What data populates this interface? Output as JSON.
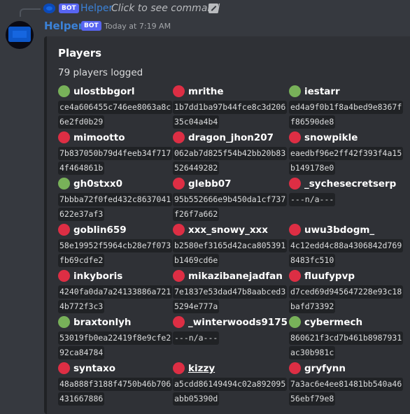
{
  "reply": {
    "badge": "BOT",
    "name": "Helper",
    "command_text": "Click to see command"
  },
  "message": {
    "author": "Helper",
    "badge": "BOT",
    "timestamp": "Today at 7:19 AM"
  },
  "embed": {
    "title": "Players",
    "description": "79 players logged",
    "fields": [
      {
        "name": "ulostbbgorl",
        "status": "green",
        "line1": "ce4a606455c746ee8063a8c",
        "line2": "6e2fd0b29"
      },
      {
        "name": "mrithe",
        "status": "red",
        "line1": "1b7dd1ba97b44fce8c3d206",
        "line2": "35c04a4b4"
      },
      {
        "name": "iestarr",
        "status": "green",
        "line1": "ed4a9f0b1f8a4bed9e8367f",
        "line2": "f86590de8"
      },
      {
        "name": "mimootto",
        "status": "red",
        "line1": "7b837050b79d4feeb34f717",
        "line2": "4f464861b"
      },
      {
        "name": "dragon_jhon207",
        "status": "red",
        "line1": "062ab7d825f54b42bb20b83",
        "line2": "526449282"
      },
      {
        "name": "snowpikle",
        "status": "red",
        "line1": "eaedbf96e2ff42f393f4a15",
        "line2": "b149178e0"
      },
      {
        "name": "gh0stxx0",
        "status": "green",
        "line1": "7bbba72f0fed432c8637041",
        "line2": "622e37af3"
      },
      {
        "name": "glebb07",
        "status": "red",
        "line1": "95b552666e9b450da1cf737",
        "line2": "f26f7a662"
      },
      {
        "name": "_sychesecretserp",
        "status": "red",
        "line1": "---n/a---",
        "line2": ""
      },
      {
        "name": "goblin659",
        "status": "red",
        "line1": "58e19952f5964cb28e7f073",
        "line2": "fb69cdfe2"
      },
      {
        "name": "xxx_snowy_xxx",
        "status": "red",
        "line1": "b2580ef3165d42aca805391",
        "line2": "b1469cd6e"
      },
      {
        "name": "uwu3bdogm_",
        "status": "red",
        "line1": "4c12edd4c88a4306842d769",
        "line2": "8483fc510"
      },
      {
        "name": "inkyboris",
        "status": "red",
        "line1": "4240fa0da7a24133886a721",
        "line2": "4b772f3c3"
      },
      {
        "name": "mikazibanejadfan",
        "status": "red",
        "line1": "7e1837e53dad47b8aabced3",
        "line2": "5294e777a"
      },
      {
        "name": "fluufypvp",
        "status": "red",
        "line1": "d7ced69d945647228e93c18",
        "line2": "bafd73392"
      },
      {
        "name": "braxtonlyh",
        "status": "green",
        "line1": "53019fb0ea22419f8e9cfe2",
        "line2": "92ca84784"
      },
      {
        "name": "_winterwoods9175",
        "status": "red",
        "line1": "---n/a---",
        "line2": ""
      },
      {
        "name": "cybermech",
        "status": "green",
        "line1": "860621f3cd7b461b8987931",
        "line2": "ac30b981c"
      },
      {
        "name": "syntaxo",
        "status": "red",
        "line1": "48a888f3188f4750b46b706",
        "line2": "431667886"
      },
      {
        "name": "kizzy",
        "status": "red",
        "underline": true,
        "line1": "a5cdd86149494c02a892095",
        "line2": "abb05390d"
      },
      {
        "name": "gryfynn",
        "status": "red",
        "line1": "7a3ac6e4ee81481bb540a46",
        "line2": "56ebf79e8"
      }
    ]
  }
}
